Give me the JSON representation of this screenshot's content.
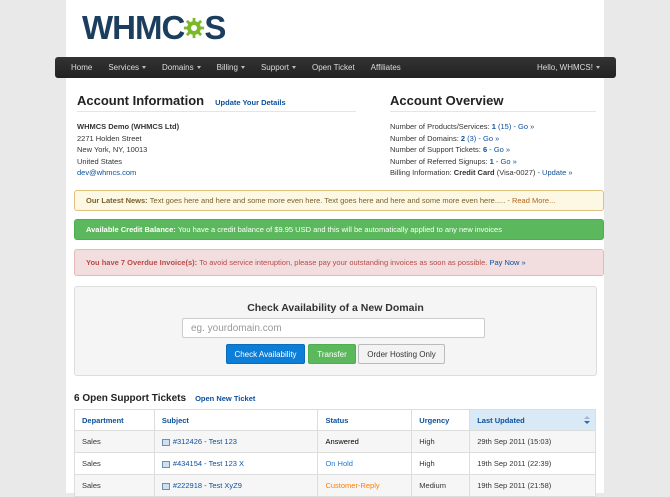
{
  "logo": {
    "text_a": "WHM",
    "text_b": "S",
    "text_c": "C"
  },
  "nav": {
    "items": [
      {
        "label": "Home"
      },
      {
        "label": "Services",
        "dropdown": true
      },
      {
        "label": "Domains",
        "dropdown": true
      },
      {
        "label": "Billing",
        "dropdown": true
      },
      {
        "label": "Support",
        "dropdown": true
      },
      {
        "label": "Open Ticket"
      },
      {
        "label": "Affiliates"
      }
    ],
    "user": "Hello, WHMCS!"
  },
  "account_info": {
    "title": "Account Information",
    "update_link": "Update Your Details",
    "name": "WHMCS Demo (WHMCS Ltd)",
    "street": "2271 Holden Street",
    "city": "New York, NY, 10013",
    "country": "United States",
    "email": "dev@whmcs.com"
  },
  "account_overview": {
    "title": "Account Overview",
    "products_label": "Number of Products/Services:",
    "products_count": "1",
    "products_total": "(15)",
    "domains_label": "Number of Domains:",
    "domains_count": "2",
    "domains_total": "(3)",
    "tickets_label": "Number of Support Tickets:",
    "tickets_count": "6",
    "referred_label": "Number of Referred Signups:",
    "referred_count": "1",
    "billing_label": "Billing Information:",
    "billing_value": "Credit Card",
    "billing_card": "(Visa-0027)",
    "go": "- Go »",
    "update": "- Update »"
  },
  "alerts": {
    "news_label": "Our Latest News:",
    "news_text": "Text goes here and here and some more even here. Text goes here and here and some more even here.....",
    "news_link": "- Read More...",
    "credit_label": "Available Credit Balance:",
    "credit_text": "You have a credit balance of $9.95 USD and this will be automatically applied to any new invoices",
    "due_label": "You have 7 Overdue Invoice(s):",
    "due_text": "To avoid service interuption, please pay your outstanding invoices as soon as possible.",
    "due_link": "Pay Now »"
  },
  "domain_check": {
    "title": "Check Availability of a New Domain",
    "placeholder": "eg. yourdomain.com",
    "btn_check": "Check Availability",
    "btn_transfer": "Transfer",
    "btn_hosting": "Order Hosting Only"
  },
  "tickets": {
    "title": "6 Open Support Tickets",
    "new_link": "Open New Ticket",
    "columns": [
      "Department",
      "Subject",
      "Status",
      "Urgency",
      "Last Updated"
    ],
    "rows": [
      {
        "department": "Sales",
        "subject": "#312426 - Test 123",
        "status": "Answered",
        "urgency": "High",
        "updated": "29th Sep 2011 (15:03)"
      },
      {
        "department": "Sales",
        "subject": "#434154 - Test 123 X",
        "status": "On Hold",
        "urgency": "High",
        "updated": "19th Sep 2011 (22:39)"
      },
      {
        "department": "Sales",
        "subject": "#222918 - Test XyZ9",
        "status": "Customer-Reply",
        "urgency": "Medium",
        "updated": "19th Sep 2011 (21:58)"
      }
    ]
  },
  "colors": {
    "brand_dark": "#1b3d5e",
    "brand_green": "#7ab929",
    "link": "#0b4f9c",
    "reply_orange": "#ff7f00",
    "onhold_blue": "#2a7ad2"
  }
}
